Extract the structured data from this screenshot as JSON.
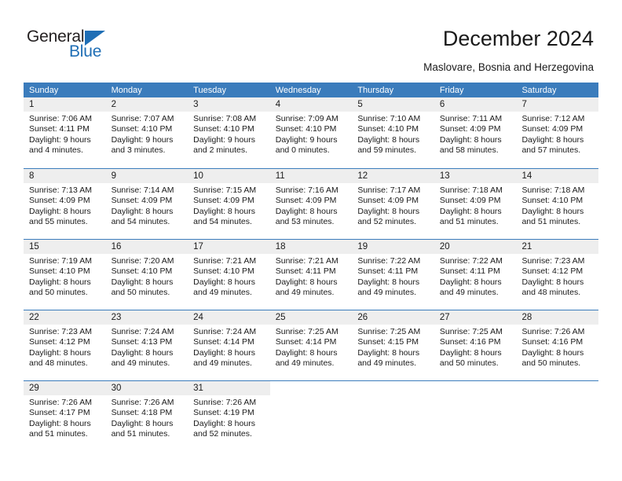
{
  "brand": {
    "name_part1": "General",
    "name_part2": "Blue",
    "accent_color": "#1f6eb5"
  },
  "header": {
    "title": "December 2024",
    "subtitle": "Maslovare, Bosnia and Herzegovina"
  },
  "calendar": {
    "header_color": "#3b7cbc",
    "daynum_band_color": "#eeeeee",
    "day_names": [
      "Sunday",
      "Monday",
      "Tuesday",
      "Wednesday",
      "Thursday",
      "Friday",
      "Saturday"
    ],
    "weeks": [
      [
        {
          "day": "1",
          "lines": [
            "Sunrise: 7:06 AM",
            "Sunset: 4:11 PM",
            "Daylight: 9 hours",
            "and 4 minutes."
          ]
        },
        {
          "day": "2",
          "lines": [
            "Sunrise: 7:07 AM",
            "Sunset: 4:10 PM",
            "Daylight: 9 hours",
            "and 3 minutes."
          ]
        },
        {
          "day": "3",
          "lines": [
            "Sunrise: 7:08 AM",
            "Sunset: 4:10 PM",
            "Daylight: 9 hours",
            "and 2 minutes."
          ]
        },
        {
          "day": "4",
          "lines": [
            "Sunrise: 7:09 AM",
            "Sunset: 4:10 PM",
            "Daylight: 9 hours",
            "and 0 minutes."
          ]
        },
        {
          "day": "5",
          "lines": [
            "Sunrise: 7:10 AM",
            "Sunset: 4:10 PM",
            "Daylight: 8 hours",
            "and 59 minutes."
          ]
        },
        {
          "day": "6",
          "lines": [
            "Sunrise: 7:11 AM",
            "Sunset: 4:09 PM",
            "Daylight: 8 hours",
            "and 58 minutes."
          ]
        },
        {
          "day": "7",
          "lines": [
            "Sunrise: 7:12 AM",
            "Sunset: 4:09 PM",
            "Daylight: 8 hours",
            "and 57 minutes."
          ]
        }
      ],
      [
        {
          "day": "8",
          "lines": [
            "Sunrise: 7:13 AM",
            "Sunset: 4:09 PM",
            "Daylight: 8 hours",
            "and 55 minutes."
          ]
        },
        {
          "day": "9",
          "lines": [
            "Sunrise: 7:14 AM",
            "Sunset: 4:09 PM",
            "Daylight: 8 hours",
            "and 54 minutes."
          ]
        },
        {
          "day": "10",
          "lines": [
            "Sunrise: 7:15 AM",
            "Sunset: 4:09 PM",
            "Daylight: 8 hours",
            "and 54 minutes."
          ]
        },
        {
          "day": "11",
          "lines": [
            "Sunrise: 7:16 AM",
            "Sunset: 4:09 PM",
            "Daylight: 8 hours",
            "and 53 minutes."
          ]
        },
        {
          "day": "12",
          "lines": [
            "Sunrise: 7:17 AM",
            "Sunset: 4:09 PM",
            "Daylight: 8 hours",
            "and 52 minutes."
          ]
        },
        {
          "day": "13",
          "lines": [
            "Sunrise: 7:18 AM",
            "Sunset: 4:09 PM",
            "Daylight: 8 hours",
            "and 51 minutes."
          ]
        },
        {
          "day": "14",
          "lines": [
            "Sunrise: 7:18 AM",
            "Sunset: 4:10 PM",
            "Daylight: 8 hours",
            "and 51 minutes."
          ]
        }
      ],
      [
        {
          "day": "15",
          "lines": [
            "Sunrise: 7:19 AM",
            "Sunset: 4:10 PM",
            "Daylight: 8 hours",
            "and 50 minutes."
          ]
        },
        {
          "day": "16",
          "lines": [
            "Sunrise: 7:20 AM",
            "Sunset: 4:10 PM",
            "Daylight: 8 hours",
            "and 50 minutes."
          ]
        },
        {
          "day": "17",
          "lines": [
            "Sunrise: 7:21 AM",
            "Sunset: 4:10 PM",
            "Daylight: 8 hours",
            "and 49 minutes."
          ]
        },
        {
          "day": "18",
          "lines": [
            "Sunrise: 7:21 AM",
            "Sunset: 4:11 PM",
            "Daylight: 8 hours",
            "and 49 minutes."
          ]
        },
        {
          "day": "19",
          "lines": [
            "Sunrise: 7:22 AM",
            "Sunset: 4:11 PM",
            "Daylight: 8 hours",
            "and 49 minutes."
          ]
        },
        {
          "day": "20",
          "lines": [
            "Sunrise: 7:22 AM",
            "Sunset: 4:11 PM",
            "Daylight: 8 hours",
            "and 49 minutes."
          ]
        },
        {
          "day": "21",
          "lines": [
            "Sunrise: 7:23 AM",
            "Sunset: 4:12 PM",
            "Daylight: 8 hours",
            "and 48 minutes."
          ]
        }
      ],
      [
        {
          "day": "22",
          "lines": [
            "Sunrise: 7:23 AM",
            "Sunset: 4:12 PM",
            "Daylight: 8 hours",
            "and 48 minutes."
          ]
        },
        {
          "day": "23",
          "lines": [
            "Sunrise: 7:24 AM",
            "Sunset: 4:13 PM",
            "Daylight: 8 hours",
            "and 49 minutes."
          ]
        },
        {
          "day": "24",
          "lines": [
            "Sunrise: 7:24 AM",
            "Sunset: 4:14 PM",
            "Daylight: 8 hours",
            "and 49 minutes."
          ]
        },
        {
          "day": "25",
          "lines": [
            "Sunrise: 7:25 AM",
            "Sunset: 4:14 PM",
            "Daylight: 8 hours",
            "and 49 minutes."
          ]
        },
        {
          "day": "26",
          "lines": [
            "Sunrise: 7:25 AM",
            "Sunset: 4:15 PM",
            "Daylight: 8 hours",
            "and 49 minutes."
          ]
        },
        {
          "day": "27",
          "lines": [
            "Sunrise: 7:25 AM",
            "Sunset: 4:16 PM",
            "Daylight: 8 hours",
            "and 50 minutes."
          ]
        },
        {
          "day": "28",
          "lines": [
            "Sunrise: 7:26 AM",
            "Sunset: 4:16 PM",
            "Daylight: 8 hours",
            "and 50 minutes."
          ]
        }
      ],
      [
        {
          "day": "29",
          "lines": [
            "Sunrise: 7:26 AM",
            "Sunset: 4:17 PM",
            "Daylight: 8 hours",
            "and 51 minutes."
          ]
        },
        {
          "day": "30",
          "lines": [
            "Sunrise: 7:26 AM",
            "Sunset: 4:18 PM",
            "Daylight: 8 hours",
            "and 51 minutes."
          ]
        },
        {
          "day": "31",
          "lines": [
            "Sunrise: 7:26 AM",
            "Sunset: 4:19 PM",
            "Daylight: 8 hours",
            "and 52 minutes."
          ]
        },
        {
          "day": "",
          "lines": []
        },
        {
          "day": "",
          "lines": []
        },
        {
          "day": "",
          "lines": []
        },
        {
          "day": "",
          "lines": []
        }
      ]
    ]
  }
}
